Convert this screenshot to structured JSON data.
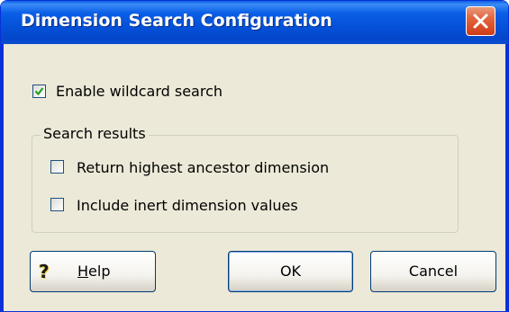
{
  "window": {
    "title": "Dimension Search Configuration",
    "close_icon": "close-icon"
  },
  "options": {
    "wildcard": {
      "label": "Enable wildcard search",
      "checked": true
    }
  },
  "search_results": {
    "group_label": "Search results",
    "items": [
      {
        "label": "Return highest ancestor dimension",
        "checked": false
      },
      {
        "label": "Include inert dimension values",
        "checked": false
      }
    ]
  },
  "buttons": {
    "help": {
      "icon": "help-question-icon",
      "accesskey": "H",
      "rest": "elp"
    },
    "ok": "OK",
    "cancel": "Cancel"
  },
  "colors": {
    "titlebar": "#0a5fe6",
    "dialog_bg": "#ece9d8",
    "close": "#e2643f"
  }
}
